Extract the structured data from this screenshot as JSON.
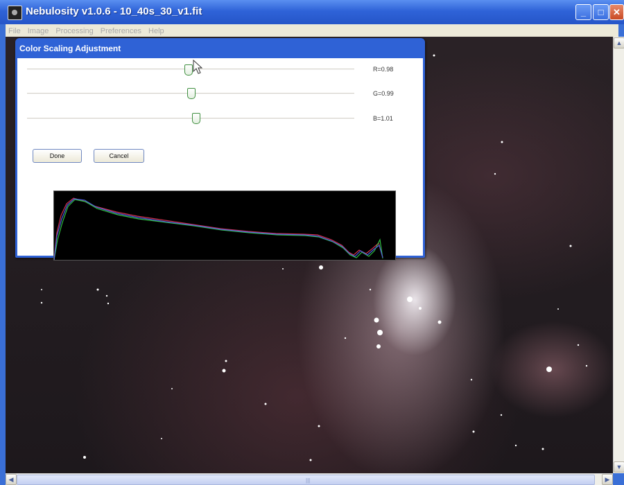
{
  "window": {
    "title": "Nebulosity v1.0.6 - 10_40s_30_v1.fit"
  },
  "menu": [
    "File",
    "Image",
    "Processing",
    "Preferences",
    "Help"
  ],
  "dialog": {
    "title": "Color Scaling Adjustment",
    "sliders": [
      {
        "label": "R=0.98",
        "value": 0.98
      },
      {
        "label": "G=0.99",
        "value": 0.99
      },
      {
        "label": "B=1.01",
        "value": 1.01
      }
    ],
    "done_label": "Done",
    "cancel_label": "Cancel"
  },
  "colors": {
    "titlebar": "#2f63d8",
    "red": "#d0304a",
    "green": "#30c040",
    "blue": "#5060e0"
  },
  "icons": [
    "app-icon",
    "minimize-icon",
    "maximize-icon",
    "close-icon",
    "scroll-up-icon",
    "scroll-down-icon",
    "scroll-left-icon",
    "scroll-right-icon",
    "mouse-cursor-icon"
  ]
}
